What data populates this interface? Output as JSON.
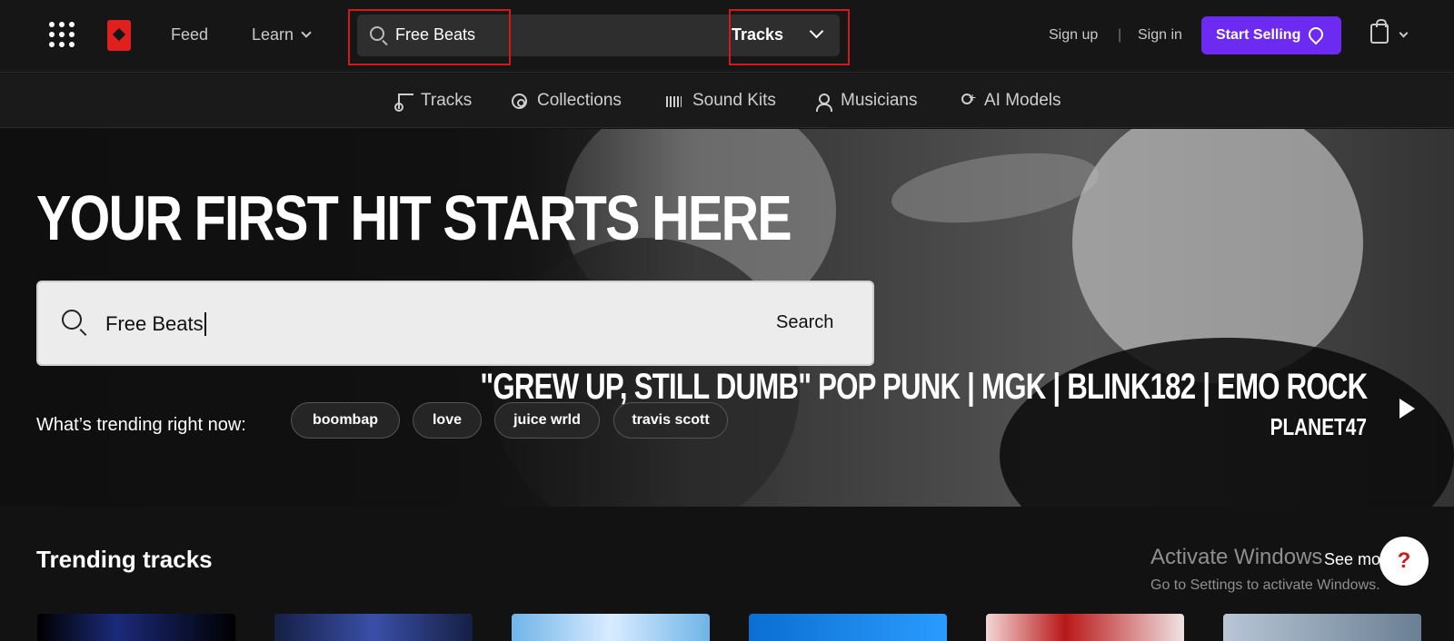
{
  "header": {
    "feed_label": "Feed",
    "learn_label": "Learn",
    "search_value": "Free Beats",
    "search_filter": "Tracks",
    "signup_label": "Sign up",
    "separator": "|",
    "signin_label": "Sign in",
    "sell_label": "Start Selling"
  },
  "subnav": {
    "items": [
      {
        "label": "Tracks",
        "icon": "music-note-icon"
      },
      {
        "label": "Collections",
        "icon": "disc-icon"
      },
      {
        "label": "Sound Kits",
        "icon": "waveform-icon"
      },
      {
        "label": "Musicians",
        "icon": "user-icon"
      },
      {
        "label": "AI Models",
        "icon": "user-plus-icon"
      }
    ]
  },
  "hero": {
    "title": "YOUR FIRST HIT STARTS HERE",
    "search_value": "Free Beats",
    "search_button": "Search",
    "trending_label": "What’s trending right now:",
    "chips": [
      "boombap",
      "love",
      "juice wrld",
      "travis scott"
    ],
    "promo_title": "\"GREW UP, STILL DUMB\" POP PUNK | MGK | BLINK182 | EMO ROCK",
    "promo_artist": "PLANET47"
  },
  "trending": {
    "title": "Trending tracks",
    "see_more": "See mo"
  },
  "overlay": {
    "activate_title": "Activate Windows",
    "activate_sub": "Go to Settings to activate Windows.",
    "help_icon": "?"
  },
  "colors": {
    "accent": "#6d2bf2",
    "brand_red": "#e0201f",
    "annotation_red": "#d11a1a"
  }
}
